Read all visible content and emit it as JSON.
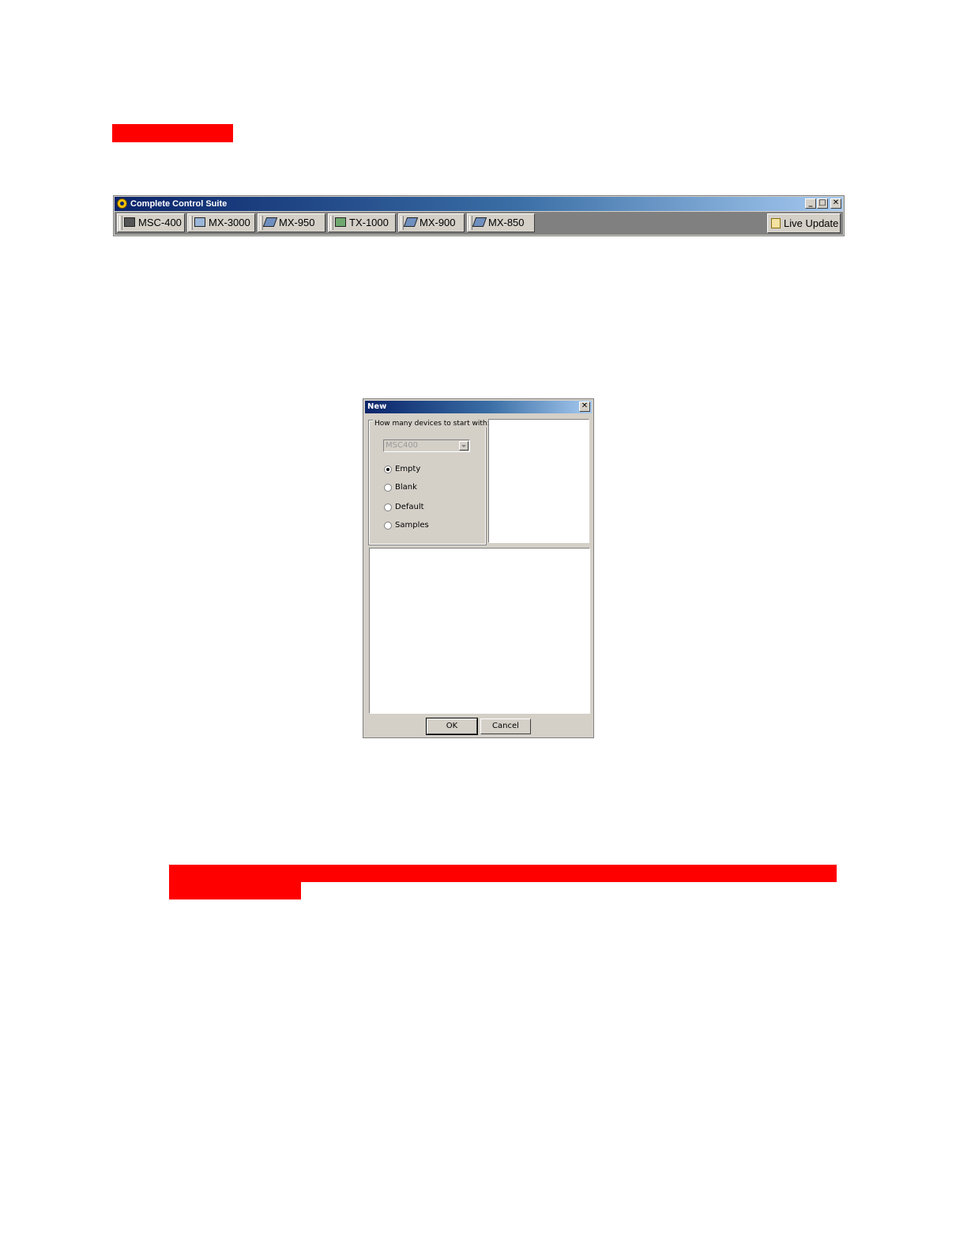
{
  "suite_window": {
    "title": "Complete Control Suite",
    "caption_buttons": [
      "_",
      "□",
      "✕"
    ],
    "device_tabs": [
      {
        "label": "MSC-400",
        "icon": "monitor-icon"
      },
      {
        "label": "MX-3000",
        "icon": "touchscreen-remote-icon"
      },
      {
        "label": "MX-950",
        "icon": "remote-icon"
      },
      {
        "label": "TX-1000",
        "icon": "touchscreen-remote-icon"
      },
      {
        "label": "MX-900",
        "icon": "remote-icon"
      },
      {
        "label": "MX-850",
        "icon": "remote-icon"
      }
    ],
    "live_update_label": "Live Update"
  },
  "new_dialog": {
    "title": "New",
    "close_glyph": "✕",
    "group_label": "How many devices to start with:",
    "device_select_value": "MSC400",
    "options": [
      {
        "label": "Empty",
        "selected": true
      },
      {
        "label": "Blank",
        "selected": false
      },
      {
        "label": "Default",
        "selected": false
      },
      {
        "label": "Samples",
        "selected": false
      }
    ],
    "ok_label": "OK",
    "cancel_label": "Cancel"
  },
  "colors": {
    "redaction": "#ff0000",
    "title_bar_start": "#0a246a",
    "title_bar_end": "#a6caf0",
    "window_face": "#d4d0c8"
  }
}
